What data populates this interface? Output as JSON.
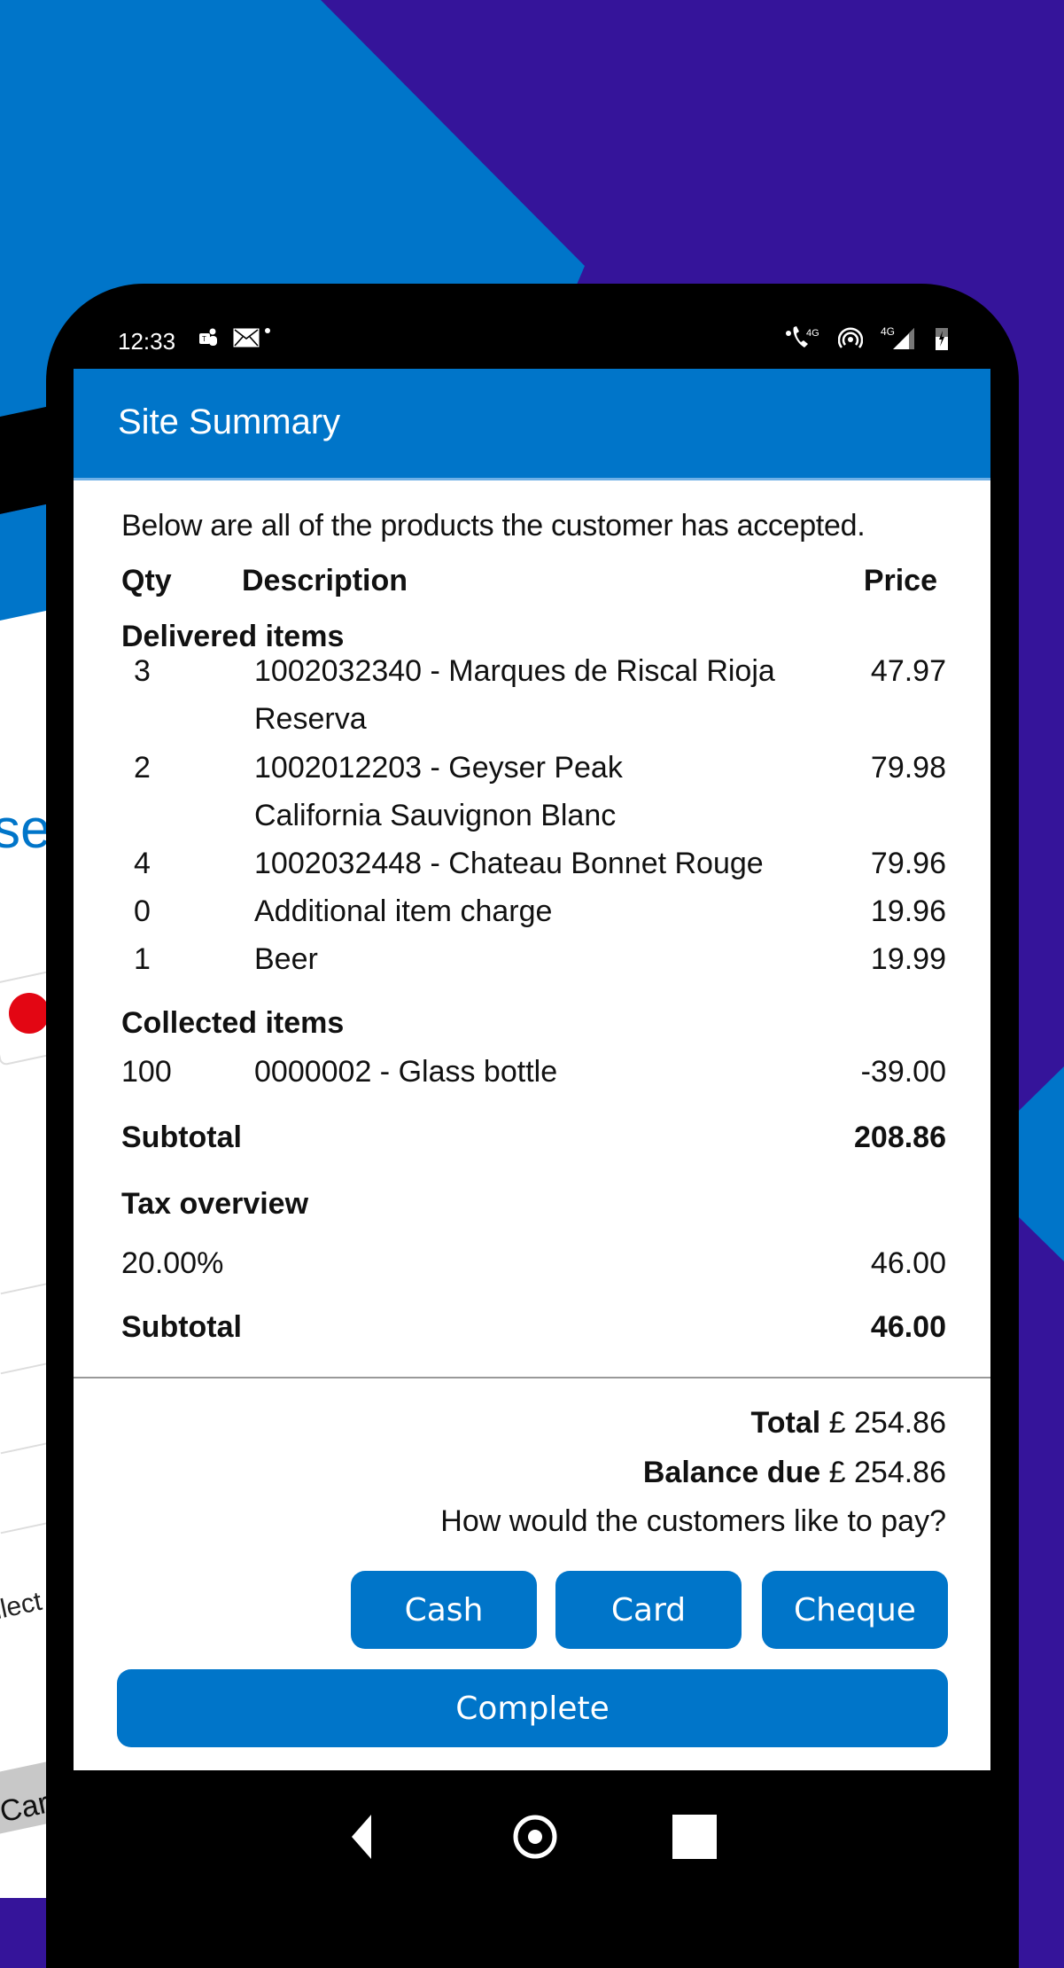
{
  "statusbar": {
    "time": "12:33",
    "left_icons": [
      "teams-icon",
      "mail-icon",
      "notification-dot-icon"
    ],
    "right_icons": [
      "volte-call-4g-icon",
      "hotspot-icon",
      "4g-signal-icon",
      "battery-charging-icon"
    ],
    "network_label": "4G"
  },
  "appbar": {
    "title": "Site Summary"
  },
  "intro": "Below are all of the products the customer has accepted.",
  "columns": {
    "qty": "Qty",
    "description": "Description",
    "price": "Price"
  },
  "delivered": {
    "title": "Delivered items",
    "items": [
      {
        "qty": "3",
        "description": "1002032340 - Marques de Riscal Rioja Reserva",
        "price": "47.97"
      },
      {
        "qty": "2",
        "description": "1002012203 - Geyser Peak California Sauvignon Blanc",
        "price": "79.98"
      },
      {
        "qty": "4",
        "description": "1002032448 - Chateau Bonnet Rouge",
        "price": "79.96"
      },
      {
        "qty": "0",
        "description": "Additional item charge",
        "price": "19.96"
      },
      {
        "qty": "1",
        "description": "Beer",
        "price": "19.99"
      }
    ]
  },
  "collected": {
    "title": "Collected items",
    "items": [
      {
        "qty": "100",
        "description": "0000002 - Glass bottle",
        "price": "-39.00"
      }
    ]
  },
  "subtotal": {
    "label": "Subtotal",
    "value": "208.86"
  },
  "tax": {
    "title": "Tax overview",
    "rows": [
      {
        "rate": "20.00%",
        "amount": "46.00"
      }
    ],
    "subtotal_label": "Subtotal",
    "subtotal_value": "46.00"
  },
  "totals": {
    "total_label": "Total",
    "total_value": "£ 254.86",
    "balance_label": "Balance due",
    "balance_value": "£ 254.86",
    "prompt": "How would the customers like to pay?"
  },
  "payment_buttons": [
    "Cash",
    "Card",
    "Cheque"
  ],
  "complete_label": "Complete",
  "navbar": [
    "back-icon",
    "home-icon",
    "recents-icon"
  ],
  "background": {
    "brand_fragment": "se",
    "select_fragment": "llect",
    "cancel_fragment": "Car",
    "colors": {
      "brand_blue": "#0075c9",
      "purple": "#35149a"
    }
  },
  "colors": {
    "primary": "#0075c9",
    "separator": "#999999"
  }
}
